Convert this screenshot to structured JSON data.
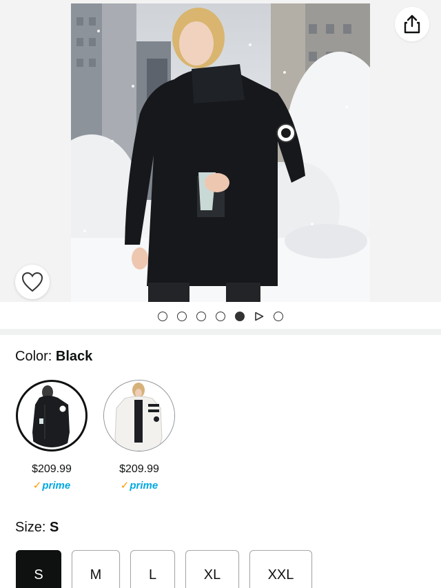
{
  "product_images": {
    "count": 7,
    "active_index": 4,
    "video_index": 5
  },
  "icons": {
    "share": "share-icon",
    "wishlist": "heart-outline-icon",
    "play": "play-icon"
  },
  "color": {
    "label_prefix": "Color: ",
    "selected_value": "Black",
    "options": [
      {
        "name": "Black",
        "price": "$209.99",
        "prime_check": "✓",
        "prime_text": "prime",
        "selected": true
      },
      {
        "name": "White",
        "price": "$209.99",
        "prime_check": "✓",
        "prime_text": "prime",
        "selected": false
      }
    ]
  },
  "size": {
    "label_prefix": "Size: ",
    "selected_value": "S",
    "options": [
      "S",
      "M",
      "L",
      "XL",
      "XXL"
    ]
  },
  "colors": {
    "text": "#0f1111",
    "prime_blue": "#00a8e1",
    "prime_check": "#ff9900",
    "selected_size_bg": "#0f1111"
  }
}
